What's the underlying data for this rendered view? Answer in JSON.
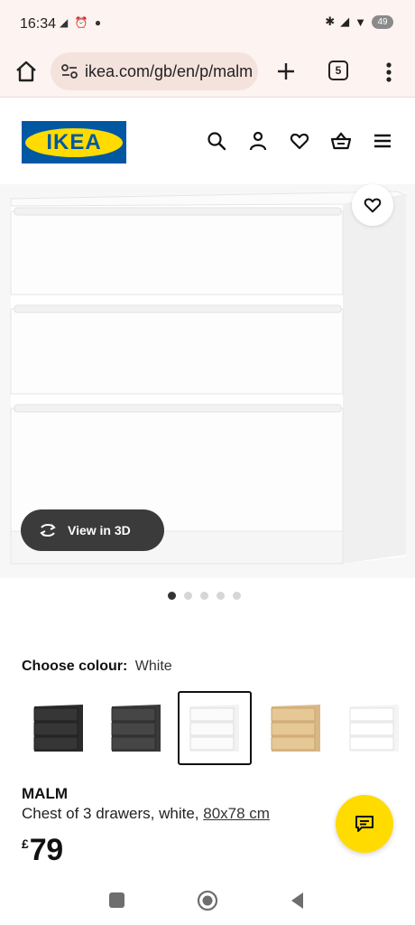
{
  "status_bar": {
    "time": "16:34",
    "left_icons": [
      "notification-icon",
      "alarm-icon",
      "messenger-icon"
    ],
    "right_icons": [
      "bluetooth-icon",
      "signal-icon",
      "wifi-icon"
    ],
    "battery": "49"
  },
  "browser": {
    "url": "ikea.com/gb/en/p/malm",
    "tab_count": "5"
  },
  "header": {
    "logo_text": "IKEA",
    "icons": [
      "search-icon",
      "user-icon",
      "heart-icon",
      "basket-icon",
      "menu-icon"
    ]
  },
  "gallery": {
    "view_3d_label": "View in 3D",
    "dot_count": 5,
    "active_dot": 0
  },
  "colour": {
    "label": "Choose colour:",
    "selected": "White",
    "swatches": [
      "black-brown",
      "dark-grey",
      "white",
      "white-stained-oak",
      "high-gloss-white"
    ],
    "selected_index": 2
  },
  "product": {
    "name": "MALM",
    "description": "Chest of 3 drawers, white,",
    "size": "80x78 cm",
    "currency": "£",
    "price": "79"
  },
  "colors": {
    "ikea_blue": "#0058a3",
    "ikea_yellow": "#ffdb00",
    "browser_bar": "#fdf3f1"
  }
}
